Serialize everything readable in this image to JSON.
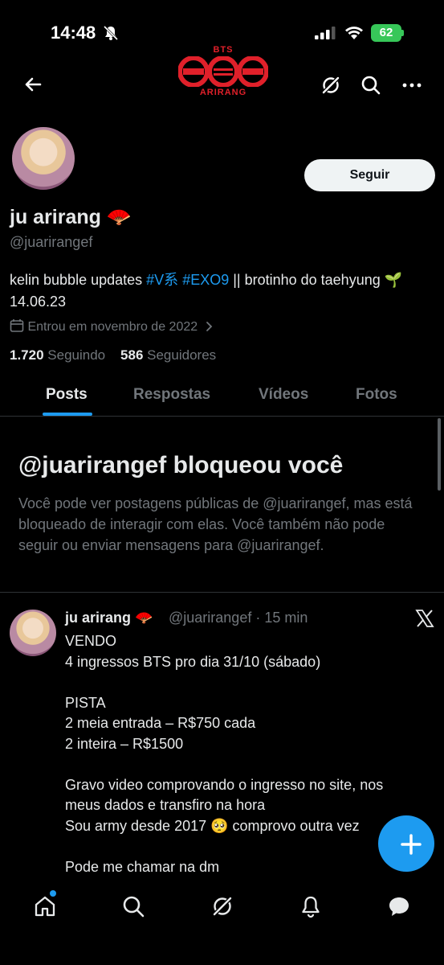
{
  "status_bar": {
    "time": "14:48",
    "battery": "62"
  },
  "banner": {
    "top": "BTS",
    "bottom": "ARIRANG"
  },
  "profile": {
    "follow_label": "Seguir",
    "display_name": "ju arirang 🪭",
    "handle": "@juarirangef",
    "bio_prefix": "kelin bubble updates ",
    "bio_tag1": "#V系",
    "bio_space": " ",
    "bio_tag2": "#EXO9",
    "bio_suffix": " || brotinho do taehyung 🌱 14.06.23",
    "joined": "Entrou em novembro de 2022",
    "following_count": "1.720",
    "following_label": "Seguindo",
    "followers_count": "586",
    "followers_label": "Seguidores"
  },
  "tabs": [
    {
      "label": "Posts"
    },
    {
      "label": "Respostas"
    },
    {
      "label": "Vídeos"
    },
    {
      "label": "Fotos"
    }
  ],
  "blocked": {
    "title": "@juarirangef bloqueou você",
    "body": "Você pode ver postagens públicas de @juarirangef, mas está bloqueado de interagir com elas. Você também não pode seguir ou enviar mensagens para @juarirangef."
  },
  "tweet": {
    "name": "ju arirang 🪭",
    "meta": "@juarirangef · 15 min",
    "body": "VENDO\n4 ingressos BTS pro dia 31/10 (sábado)\n\nPISTA\n2 meia entrada – R$750 cada\n2 inteira – R$1500\n\nGravo video comprovando o ingresso no site, nos meus dados e transfiro na hora\nSou army desde 2017 🥺 comprovo outra vez\n\nPode me chamar na dm"
  },
  "icons": {
    "back": "arrow-left-icon",
    "grok": "grok-icon",
    "search": "search-icon",
    "more": "more-icon",
    "home": "home-icon",
    "explore": "search-icon",
    "grok_nav": "grok-icon",
    "notifications": "bell-icon",
    "messages": "chat-bubble-icon",
    "compose": "plus-icon"
  },
  "colors": {
    "accent": "#1d9bf0",
    "background": "#000000",
    "muted": "#71767b",
    "banner_red": "#e0202a"
  }
}
